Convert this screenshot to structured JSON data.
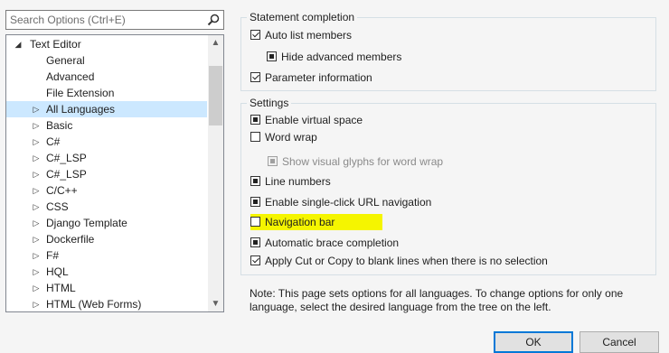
{
  "search": {
    "placeholder": "Search Options (Ctrl+E)"
  },
  "tree": {
    "items": [
      {
        "label": "Text Editor",
        "expanded": true
      },
      {
        "label": "General"
      },
      {
        "label": "Advanced"
      },
      {
        "label": "File Extension"
      },
      {
        "label": "All Languages",
        "selected": true
      },
      {
        "label": "Basic"
      },
      {
        "label": "C#"
      },
      {
        "label": "C#_LSP"
      },
      {
        "label": "C#_LSP"
      },
      {
        "label": "C/C++"
      },
      {
        "label": "CSS"
      },
      {
        "label": "Django Template"
      },
      {
        "label": "Dockerfile"
      },
      {
        "label": "F#"
      },
      {
        "label": "HQL"
      },
      {
        "label": "HTML"
      },
      {
        "label": "HTML (Web Forms)"
      }
    ]
  },
  "statement_completion": {
    "title": "Statement completion",
    "auto_list_members": {
      "label": "Auto list members",
      "state": "checked"
    },
    "hide_advanced_members": {
      "label": "Hide advanced members",
      "state": "indeterminate"
    },
    "parameter_information": {
      "label": "Parameter information",
      "state": "checked"
    }
  },
  "settings": {
    "title": "Settings",
    "enable_virtual_space": {
      "label": "Enable virtual space",
      "state": "indeterminate"
    },
    "word_wrap": {
      "label": "Word wrap",
      "state": "unchecked"
    },
    "show_visual_glyphs": {
      "label": "Show visual glyphs for word wrap",
      "state": "indeterminate-disabled"
    },
    "line_numbers": {
      "label": "Line numbers",
      "state": "indeterminate"
    },
    "single_click_url": {
      "label": "Enable single-click URL navigation",
      "state": "indeterminate"
    },
    "navigation_bar": {
      "label": "Navigation bar",
      "state": "unchecked",
      "highlight_color": "#f5f500"
    },
    "automatic_brace": {
      "label": "Automatic brace completion",
      "state": "indeterminate"
    },
    "apply_cut_copy": {
      "label": "Apply Cut or Copy to blank lines when there is no selection",
      "state": "checked"
    }
  },
  "note": "Note: This page sets options for all languages. To change options for only one language, select the desired language from the tree on the left.",
  "buttons": {
    "ok": "OK",
    "cancel": "Cancel"
  },
  "colors": {
    "selection": "#cce8ff",
    "default_button_border": "#0078d7"
  }
}
